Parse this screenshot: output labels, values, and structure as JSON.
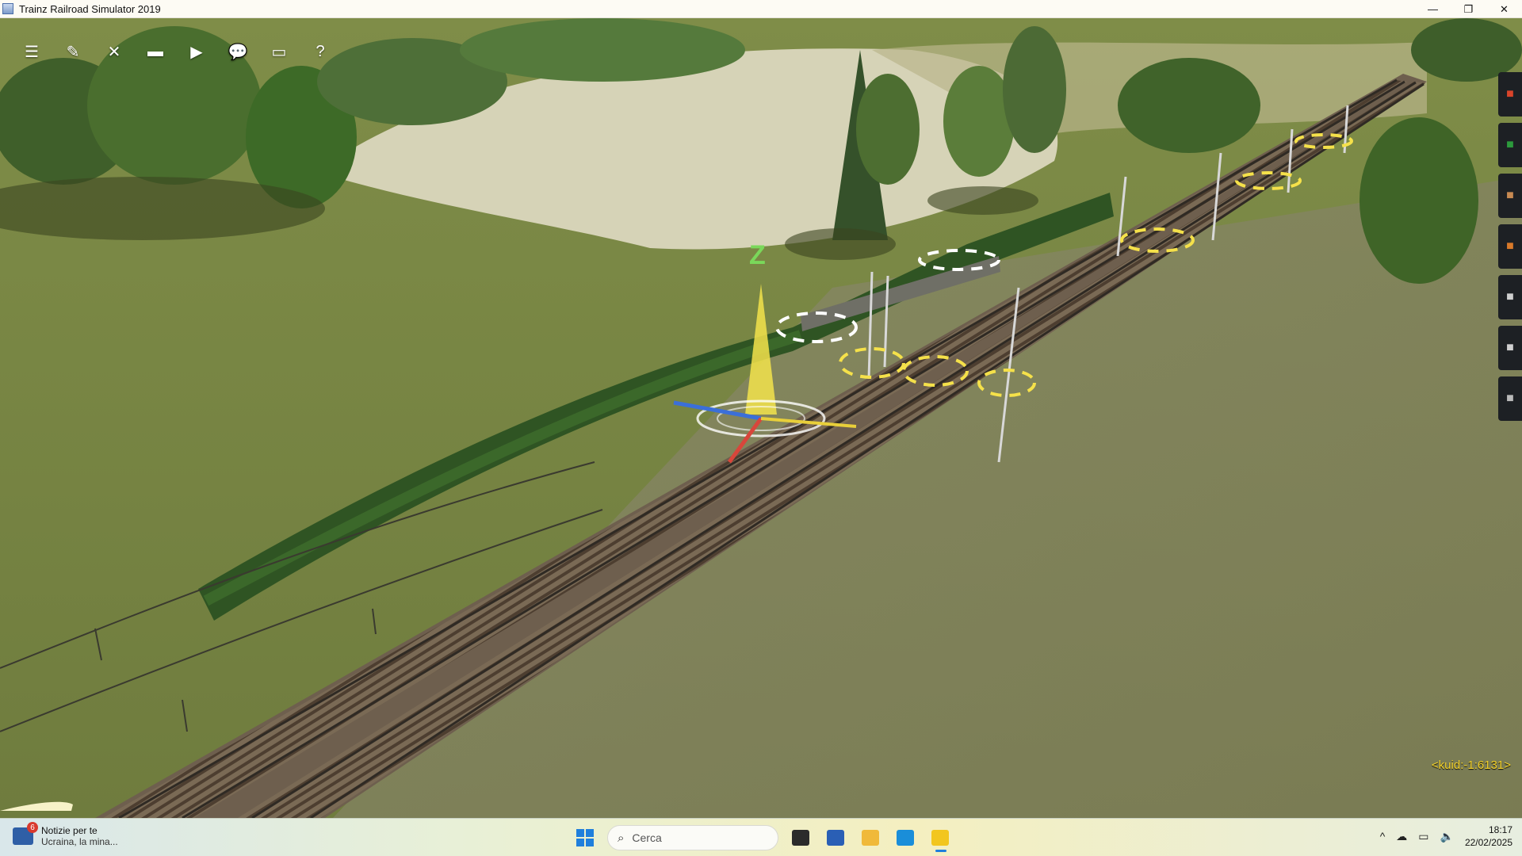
{
  "window": {
    "title": "Trainz Railroad Simulator 2019",
    "controls": {
      "minimize": "—",
      "restore": "❐",
      "close": "✕"
    }
  },
  "toolbar": [
    {
      "name": "menu-icon",
      "glyph": "☰"
    },
    {
      "name": "edit-icon",
      "glyph": "✎"
    },
    {
      "name": "tools-icon",
      "glyph": "✕"
    },
    {
      "name": "display-icon",
      "glyph": "▬"
    },
    {
      "name": "camera-icon",
      "glyph": "▶"
    },
    {
      "name": "chat-icon",
      "glyph": "💬"
    },
    {
      "name": "window-icon",
      "glyph": "▭"
    },
    {
      "name": "help-icon",
      "glyph": "?"
    }
  ],
  "side_panel": [
    {
      "name": "object-tool-icon",
      "color": "#d9442a"
    },
    {
      "name": "track-tool-icon",
      "color": "#2c9a3c"
    },
    {
      "name": "train-tool-icon",
      "color": "#c88a52"
    },
    {
      "name": "trackside-tool-icon",
      "color": "#d97a2a"
    },
    {
      "name": "wrench-tool-icon",
      "color": "#cfcfcf"
    },
    {
      "name": "layers-tool-icon",
      "color": "#d0d0d0"
    },
    {
      "name": "settings-tool-icon",
      "color": "#bbbbbb"
    }
  ],
  "gizmo": {
    "axis_label": "Z"
  },
  "status": {
    "kuid": "<kuid:-1:6131>"
  },
  "taskbar": {
    "news_title": "Notizie per te",
    "news_subtitle": "Ucraina, la mina...",
    "news_badge": "6",
    "search_placeholder": "Cerca",
    "time": "18:17",
    "date": "22/02/2025",
    "apps": [
      {
        "name": "task-view-icon",
        "color": "#2b2b2b",
        "active": false
      },
      {
        "name": "store-icon",
        "color": "#2a5fb5",
        "active": false
      },
      {
        "name": "file-explorer-icon",
        "color": "#f0b93a",
        "active": false
      },
      {
        "name": "edge-icon",
        "color": "#1a8ed9",
        "active": false
      },
      {
        "name": "trainz-app-icon",
        "color": "#f2c61f",
        "active": true
      }
    ]
  }
}
